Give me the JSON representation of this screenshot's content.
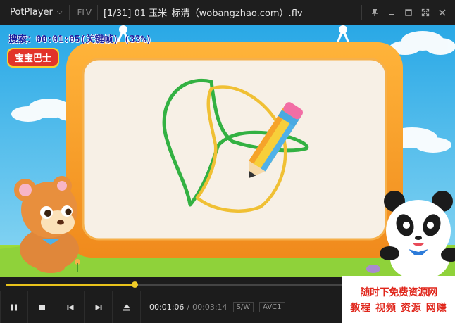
{
  "titlebar": {
    "app_name": "PotPlayer",
    "format": "FLV",
    "title": "[1/31] 01 玉米_标清（wobangzhao.com）.flv",
    "icons": [
      "pin-icon",
      "minimize-icon",
      "maximize-icon",
      "fullscreen-icon",
      "close-icon"
    ]
  },
  "video": {
    "osd_text": "搜索：00:01:05(关键帧) (33%)",
    "logo_text": "宝宝巴士"
  },
  "playback": {
    "progress": 0.29,
    "current_time": "00:01:06",
    "separator": "/",
    "total_time": "00:03:14",
    "tag_sw": "S/W",
    "tag_codec": "AVC1"
  },
  "controls": [
    "pause-icon",
    "stop-icon",
    "previous-icon",
    "next-icon",
    "eject-icon"
  ],
  "watermark": {
    "line1": "随时下免费资源网",
    "line2": "教程 视频 资源 网赚"
  },
  "colors": {
    "accent": "#e8c21b",
    "sky": "#38b7ea",
    "board": "#f39a22"
  }
}
